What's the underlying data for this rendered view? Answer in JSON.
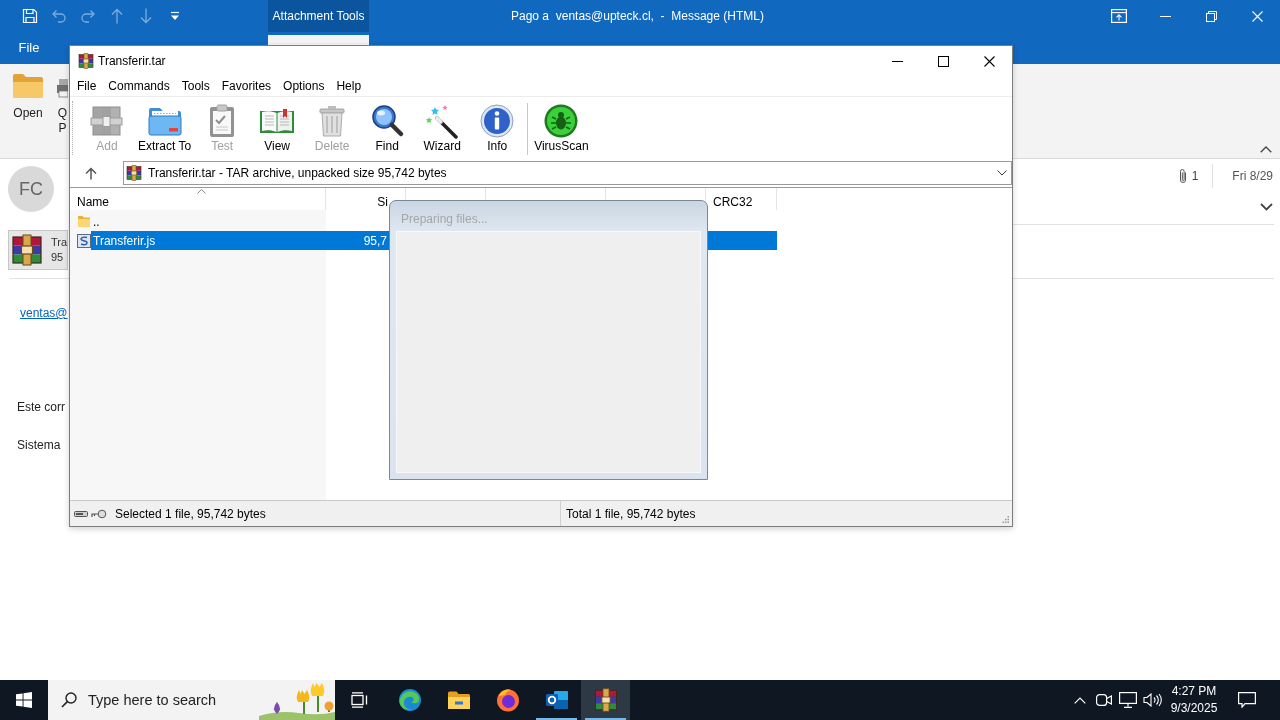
{
  "mail_window": {
    "quick_access": [
      {
        "kind": "save",
        "disabled": false
      },
      {
        "kind": "undo",
        "disabled": true
      },
      {
        "kind": "redo",
        "disabled": true
      },
      {
        "kind": "up",
        "disabled": true
      },
      {
        "kind": "down",
        "disabled": true
      },
      {
        "kind": "customize",
        "disabled": false
      }
    ],
    "contextual_tab": "Attachment Tools",
    "title": "Pago a  ventas@upteck.cl,  -  Message (HTML)",
    "file_tab": "File",
    "ribbon_buttons": [
      {
        "kind": "open",
        "lines": [
          "Open"
        ]
      },
      {
        "kind": "quick-print",
        "lines": [
          "Q",
          "P"
        ]
      }
    ],
    "message": {
      "avatar": "FC",
      "attachment_count": "1",
      "date": "Fri 8/29",
      "attachment": {
        "name": "Tra",
        "size": "95"
      },
      "body": [
        {
          "kind": "link",
          "text": "ventas@"
        },
        {
          "kind": "text",
          "text": "Este corr"
        },
        {
          "kind": "text",
          "text": "Sistema"
        }
      ]
    }
  },
  "archive_window": {
    "title": "Transferir.tar",
    "menu": [
      "File",
      "Commands",
      "Tools",
      "Favorites",
      "Options",
      "Help"
    ],
    "toolbar": [
      {
        "kind": "add",
        "label": "Add",
        "disabled": true
      },
      {
        "kind": "extract",
        "label": "Extract To",
        "disabled": false
      },
      {
        "kind": "test",
        "label": "Test",
        "disabled": true
      },
      {
        "kind": "view",
        "label": "View",
        "disabled": false
      },
      {
        "kind": "delete",
        "label": "Delete",
        "disabled": true
      },
      {
        "kind": "find",
        "label": "Find",
        "disabled": false
      },
      {
        "kind": "wizard",
        "label": "Wizard",
        "disabled": false
      },
      {
        "kind": "info",
        "label": "Info",
        "disabled": false
      },
      {
        "kind": "virusscan",
        "label": "VirusScan",
        "disabled": false
      }
    ],
    "path": "Transferir.tar - TAR archive, unpacked size 95,742 bytes",
    "columns": [
      {
        "label": "Name",
        "sorted": true
      },
      {
        "label": "Si",
        "sorted": false
      },
      {
        "label": "CRC32",
        "sorted": false
      }
    ],
    "rows": [
      {
        "kind": "folder",
        "name": "..",
        "selected": false
      },
      {
        "kind": "script",
        "name": "Transferir.js",
        "size": "95,7",
        "selected": true
      }
    ],
    "status": [
      "Selected 1 file, 95,742 bytes",
      "Total 1 file, 95,742 bytes"
    ]
  },
  "progress_dialog": {
    "title": "Preparing files..."
  },
  "taskbar": {
    "search": {
      "placeholder": "Type here to search"
    },
    "apps": [
      {
        "kind": "edge",
        "open": false,
        "selected": false
      },
      {
        "kind": "explorer",
        "open": false,
        "selected": false
      },
      {
        "kind": "firefox",
        "open": false,
        "selected": false
      },
      {
        "kind": "outlook",
        "open": true,
        "selected": false
      },
      {
        "kind": "winrar",
        "open": true,
        "selected": true
      }
    ],
    "clock": {
      "time": "4:27 PM",
      "date": "9/3/2025"
    }
  }
}
